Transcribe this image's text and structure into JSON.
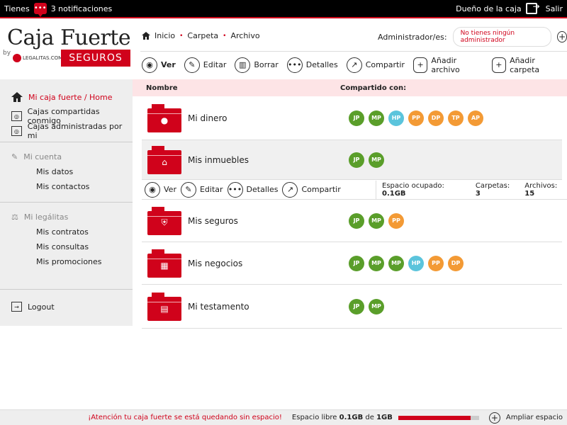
{
  "topbar": {
    "tienes": "Tienes",
    "notifications": "3 notificaciones",
    "owner": "Dueño de la caja",
    "exit": "Salir"
  },
  "logo": {
    "title": "Caja Fuerte",
    "by": "by",
    "legalitas": "LEGALITAS.COM",
    "seguros": "SEGUROS"
  },
  "breadcrumb": [
    "Inicio",
    "Carpeta",
    "Archivo"
  ],
  "admin": {
    "label": "Administrador/es:",
    "none": "No tienes ningún administrador"
  },
  "toolbar": {
    "ver": "Ver",
    "editar": "Editar",
    "borrar": "Borrar",
    "detalles": "Detalles",
    "compartir": "Compartir",
    "add_file": "Añadir archivo",
    "add_folder": "Añadir carpeta"
  },
  "sidebar": {
    "home": "Mi caja fuerte / Home",
    "shared": "Cajas compartidas conmigo",
    "managed": "Cajas administradas por mi",
    "account": "Mi cuenta",
    "datos": "Mis datos",
    "contactos": "Mis contactos",
    "legalitas": "Mi legálitas",
    "contratos": "Mis contratos",
    "consultas": "Mis consultas",
    "promociones": "Mis promociones",
    "logout": "Logout"
  },
  "table": {
    "col_name": "Nombre",
    "col_shared": "Compartido con:",
    "rows": [
      {
        "name": "Mi dinero",
        "icon": "coin-icon",
        "avatars": [
          "JP",
          "MP",
          "HP",
          "PP",
          "DP",
          "TP",
          "AP"
        ]
      },
      {
        "name": "Mis inmuebles",
        "icon": "house-icon",
        "avatars": [
          "JP",
          "MP"
        ]
      },
      {
        "name": "Mis seguros",
        "icon": "shield-icon",
        "avatars": [
          "JP",
          "MP",
          "PP"
        ]
      },
      {
        "name": "Mis negocios",
        "icon": "chart-icon",
        "avatars": [
          "JP",
          "MP",
          "MP",
          "HP",
          "PP",
          "DP"
        ]
      },
      {
        "name": "Mi testamento",
        "icon": "document-icon",
        "avatars": [
          "JP",
          "MP"
        ]
      }
    ]
  },
  "subbar": {
    "ver": "Ver",
    "editar": "Editar",
    "detalles": "Detalles",
    "compartir": "Compartir",
    "space_label": "Espacio ocupado:",
    "space_value": "0.1GB",
    "folders_label": "Carpetas:",
    "folders_value": "3",
    "files_label": "Archivos:",
    "files_value": "15"
  },
  "bottom": {
    "warning": "¡Atención tu caja fuerte se está quedando sin espacio!",
    "free_label": "Espacio libre",
    "free_value": "0.1GB",
    "of": "de",
    "total": "1GB",
    "used_fraction": 0.9,
    "expand": "Ampliar espacio"
  },
  "colors": {
    "accent": "#d0021b",
    "JP": "#5a9e2a",
    "MP": "#5a9e2a",
    "HP": "#5bc4dc",
    "PP": "#f39a35",
    "DP": "#f39a35",
    "TP": "#f39a35",
    "AP": "#f39a35"
  }
}
